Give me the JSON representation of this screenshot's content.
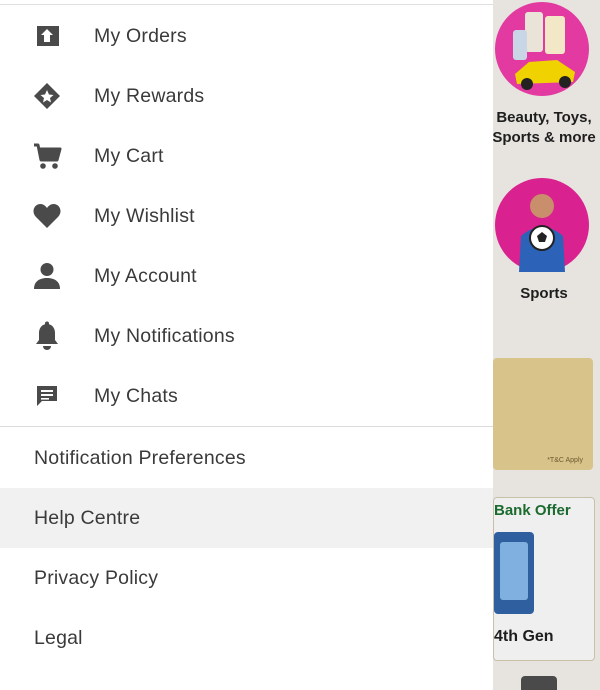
{
  "drawer": {
    "menu": [
      {
        "label": "My Orders",
        "icon": "orders-icon"
      },
      {
        "label": "My Rewards",
        "icon": "rewards-icon"
      },
      {
        "label": "My Cart",
        "icon": "cart-icon"
      },
      {
        "label": "My Wishlist",
        "icon": "heart-icon"
      },
      {
        "label": "My Account",
        "icon": "person-icon"
      },
      {
        "label": "My Notifications",
        "icon": "bell-icon"
      },
      {
        "label": "My Chats",
        "icon": "chat-icon"
      }
    ],
    "links": [
      {
        "label": "Notification Preferences",
        "active": false
      },
      {
        "label": "Help Centre",
        "active": true
      },
      {
        "label": "Privacy Policy",
        "active": false
      },
      {
        "label": "Legal",
        "active": false
      }
    ]
  },
  "background": {
    "categories": [
      {
        "label": "Beauty, Toys,",
        "label2": "Sports & more"
      },
      {
        "label": "Sports"
      }
    ],
    "promo_note": "*T&C Apply",
    "offer_title": "Bank Offer",
    "offer_product": "4th Gen"
  },
  "colors": {
    "icon": "#4a4a4a",
    "text": "#3a3a3a",
    "active_row": "#f1f1f1",
    "offer_green": "#1b6b2f"
  }
}
